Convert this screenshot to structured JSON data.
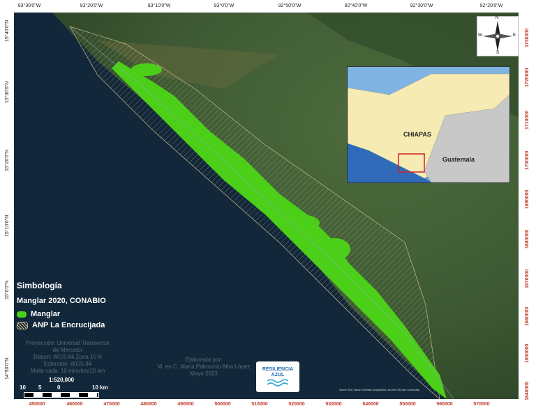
{
  "axes": {
    "top_ticks": [
      "93°30'0\"W",
      "93°20'0\"W",
      "93°10'0\"W",
      "93°0'0\"W",
      "92°50'0\"W",
      "92°40'0\"W",
      "92°30'0\"W",
      "92°20'0\"W"
    ],
    "bottom_ticks": [
      "450000",
      "460000",
      "470000",
      "480000",
      "490000",
      "500000",
      "510000",
      "520000",
      "530000",
      "540000",
      "550000",
      "560000",
      "570000"
    ],
    "left_ticks": [
      "15°40'0\"N",
      "15°30'0\"N",
      "15°20'0\"N",
      "15°10'0\"N",
      "15°0'0\"N",
      "14°50'0\"N"
    ],
    "right_ticks": [
      "1730000",
      "1720000",
      "1710000",
      "1700000",
      "1690000",
      "1680000",
      "1670000",
      "1660000",
      "1650000",
      "1640000"
    ]
  },
  "legend": {
    "title": "Simbología",
    "subtitle": "Manglar 2020, CONABIO",
    "items": [
      {
        "label": "Manglar",
        "color": "#4ccf18"
      },
      {
        "label": "ANP La Encrucijada",
        "color": "#c9b98a"
      }
    ]
  },
  "projection": [
    "Proyección: Universal Transversa",
    "de Mercator",
    "Datum: WGS 84 Zona 15 N",
    "Esferoide: WGS 84",
    "Malla cada: 10 minutos/10 km"
  ],
  "scale": {
    "ratio": "1:520,000",
    "labels": [
      "10",
      "5",
      "0",
      "10 km"
    ]
  },
  "credits": [
    "Elaborado por:",
    "M. en C. María Patrocinio Alba López",
    "Mayo 2023"
  ],
  "logo": {
    "line1": "RESILIENCIA",
    "line2": "AZUL"
  },
  "source": "Source: Esri, Maxar, Earthstar Geographics, and the GIS User Community",
  "north_arrow": {
    "n": "N",
    "s": "S",
    "e": "E",
    "w": "W"
  },
  "inset": {
    "state_label": "CHIAPAS",
    "country_label": "Guatemala"
  },
  "colors": {
    "mangrove": "#4ccf18",
    "sea": "#0f2436",
    "land": "#3e5a34",
    "anp_hatch": "#c9b98a",
    "grid_label_red": "#c0392b"
  }
}
